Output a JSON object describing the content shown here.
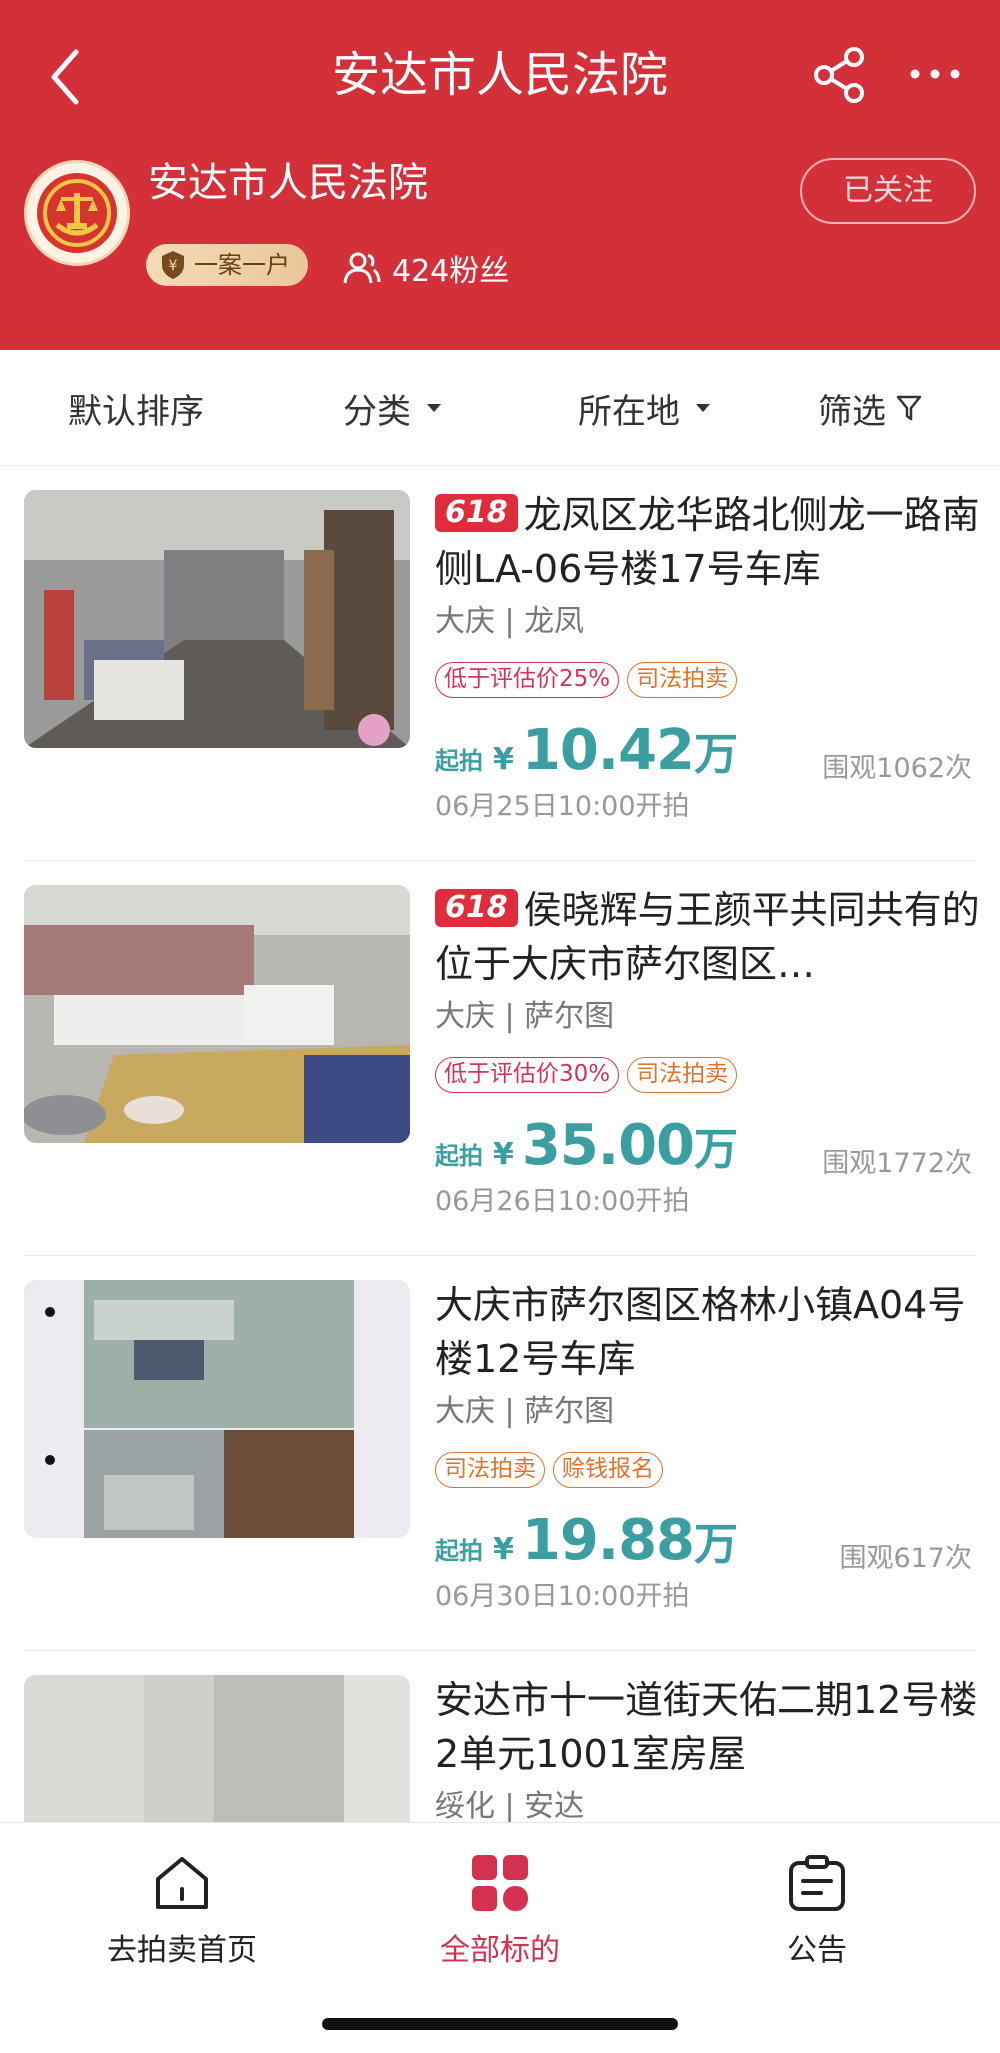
{
  "header": {
    "title": "安达市人民法院",
    "court_name": "安达市人民法院",
    "badge": "一案一户",
    "fans": "424粉丝",
    "follow": "已关注"
  },
  "sortbar": {
    "default_sort": "默认排序",
    "category": "分类",
    "location": "所在地",
    "filter": "筛选"
  },
  "items": [
    {
      "promo": "618",
      "title": "龙凤区龙华路北侧龙一路南侧LA-06号楼17号车库",
      "location": "大庆 | 龙凤",
      "tags": [
        "低于评估价25%",
        "司法拍卖"
      ],
      "price_label": "起拍",
      "currency": "¥",
      "price": "10.42",
      "unit": "万",
      "views": "围观1062次",
      "start": "06月25日10:00开拍"
    },
    {
      "promo": "618",
      "title": "侯晓辉与王颜平共同共有的位于大庆市萨尔图区…",
      "location": "大庆 | 萨尔图",
      "tags": [
        "低于评估价30%",
        "司法拍卖"
      ],
      "price_label": "起拍",
      "currency": "¥",
      "price": "35.00",
      "unit": "万",
      "views": "围观1772次",
      "start": "06月26日10:00开拍"
    },
    {
      "promo": "",
      "title": "大庆市萨尔图区格林小镇A04号楼12号车库",
      "location": "大庆 | 萨尔图",
      "tags": [
        "司法拍卖",
        "赊钱报名"
      ],
      "price_label": "起拍",
      "currency": "¥",
      "price": "19.88",
      "unit": "万",
      "views": "围观617次",
      "start": "06月30日10:00开拍"
    },
    {
      "promo": "",
      "title": "安达市十一道街天佑二期12号楼2单元1001室房屋",
      "location": "绥化 | 安达"
    }
  ],
  "tabbar": {
    "home": "去拍卖首页",
    "all": "全部标的",
    "notice": "公告"
  },
  "colors": {
    "header_red": "#d4303a",
    "price_teal": "#3b9fa2",
    "tab_active": "#d4304f"
  }
}
